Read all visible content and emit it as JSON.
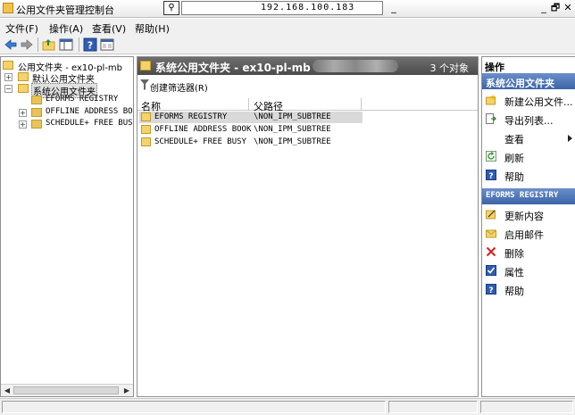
{
  "window": {
    "title": "公用文件夹管理控制台",
    "remote_host": "192.168.100.183",
    "controls": [
      "_",
      "🗗",
      "✕"
    ]
  },
  "menu": [
    {
      "label": "文件(F)"
    },
    {
      "label": "操作(A)"
    },
    {
      "label": "查看(V)"
    },
    {
      "label": "帮助(H)"
    }
  ],
  "toolbar": {
    "buttons": [
      "back-icon",
      "forward-icon",
      "up-folder-icon",
      "show-hide-tree-icon",
      "help-icon",
      "properties-view-icon"
    ]
  },
  "tree": {
    "root": "公用文件夹 - ex10-pl-mb",
    "default_folders": "默认公用文件夹",
    "system_folders": "系统公用文件夹",
    "children": [
      {
        "label": "EFORMS REGISTRY"
      },
      {
        "label": "OFFLINE ADDRESS BOO"
      },
      {
        "label": "SCHEDULE+ FREE BUSY"
      }
    ]
  },
  "main": {
    "title": "系统公用文件夹 - ex10-pl-mb",
    "count": "3 个对象",
    "filter_label": "创建筛选器(R)",
    "columns": {
      "name": "名称",
      "path": "父路径"
    },
    "rows": [
      {
        "name": "EFORMS REGISTRY",
        "path": "\\NON_IPM_SUBTREE",
        "selected": true
      },
      {
        "name": "OFFLINE ADDRESS BOOK",
        "path": "\\NON_IPM_SUBTREE",
        "selected": false
      },
      {
        "name": "SCHEDULE+ FREE BUSY",
        "path": "\\NON_IPM_SUBTREE",
        "selected": false
      }
    ]
  },
  "actions": {
    "title": "操作",
    "group1": {
      "title": "系统公用文件夹",
      "items": [
        {
          "label": "新建公用文件...",
          "icon": "new-folder-icon"
        },
        {
          "label": "导出列表...",
          "icon": "export-list-icon"
        },
        {
          "label": "查看",
          "icon": "view-icon"
        },
        {
          "label": "刷新",
          "icon": "refresh-icon"
        },
        {
          "label": "帮助",
          "icon": "help-icon"
        }
      ]
    },
    "group2": {
      "title": "EFORMS REGISTRY",
      "items": [
        {
          "label": "更新内容",
          "icon": "update-content-icon"
        },
        {
          "label": "启用邮件",
          "icon": "mail-enable-icon"
        },
        {
          "label": "删除",
          "icon": "delete-icon"
        },
        {
          "label": "属性",
          "icon": "properties-icon"
        },
        {
          "label": "帮助",
          "icon": "help-icon"
        }
      ]
    }
  },
  "colors": {
    "header_gray": "#5a5a5a",
    "action_group_blue": "#3c64a8",
    "folder_yellow": "#f4d36a",
    "selection_gray": "#d9d9d9"
  }
}
